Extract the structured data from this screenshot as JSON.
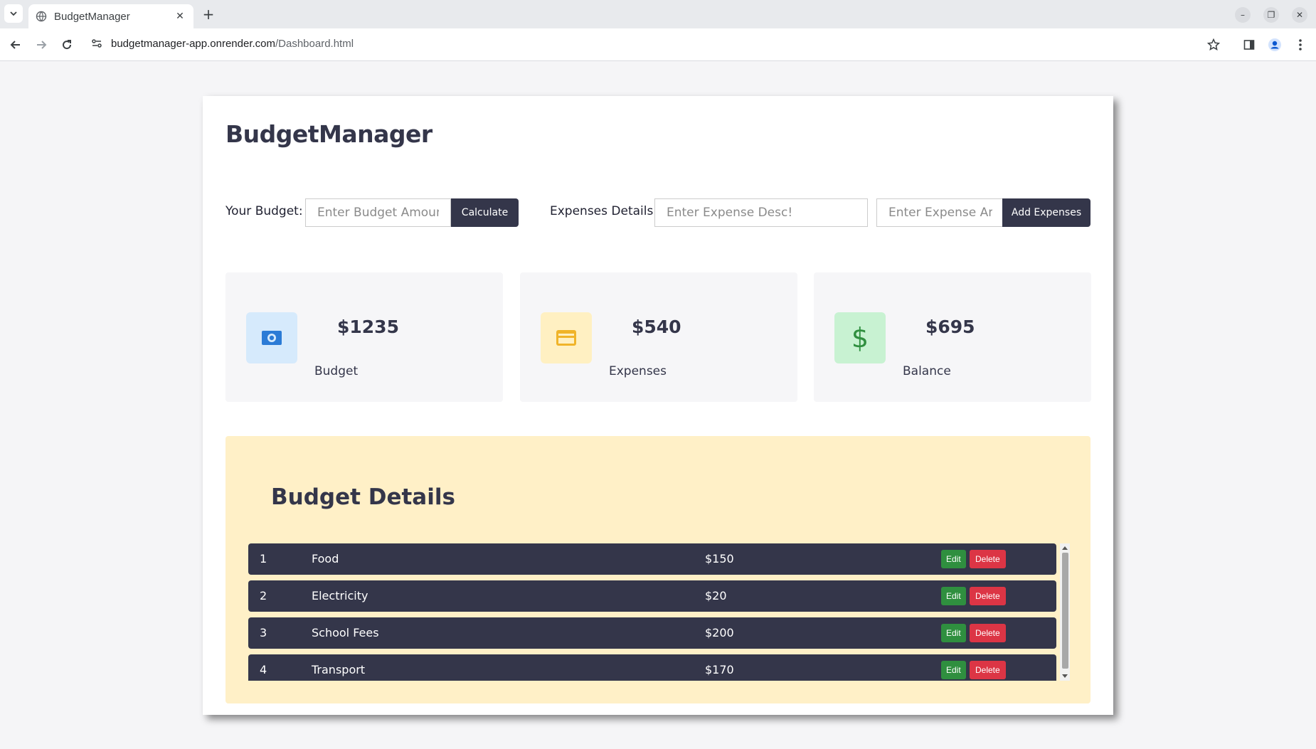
{
  "browser": {
    "tab_title": "BudgetManager",
    "url_host": "budgetmanager-app.onrender.com",
    "url_path": "/Dashboard.html"
  },
  "app": {
    "title": "BudgetManager"
  },
  "budget_form": {
    "label": "Your Budget:",
    "placeholder": "Enter Budget Amount",
    "button": "Calculate"
  },
  "expense_form": {
    "label": "Expenses Details:",
    "desc_placeholder": "Enter Expense Desc!",
    "amount_placeholder": "Enter Expense Amount",
    "button": "Add Expenses"
  },
  "stats": [
    {
      "value": "$1235",
      "caption": "Budget",
      "icon": "money-icon",
      "color": "#2b7bd6",
      "bg": "#d6eafc"
    },
    {
      "value": "$540",
      "caption": "Expenses",
      "icon": "credit-card-icon",
      "color": "#f0b429",
      "bg": "#fff0c2"
    },
    {
      "value": "$695",
      "caption": "Balance",
      "icon": "dollar-icon",
      "color": "#2f8f3f",
      "bg": "#c8f2d2"
    }
  ],
  "details": {
    "title": "Budget Details",
    "edit_label": "Edit",
    "delete_label": "Delete",
    "rows": [
      {
        "index": "1",
        "name": "Food",
        "amount": "$150"
      },
      {
        "index": "2",
        "name": "Electricity",
        "amount": "$20"
      },
      {
        "index": "3",
        "name": "School Fees",
        "amount": "$200"
      },
      {
        "index": "4",
        "name": "Transport",
        "amount": "$170"
      }
    ]
  },
  "colors": {
    "dark": "#34364a",
    "edit": "#2f8f3f",
    "delete": "#dc3545",
    "details_bg": "#fff0c7"
  }
}
